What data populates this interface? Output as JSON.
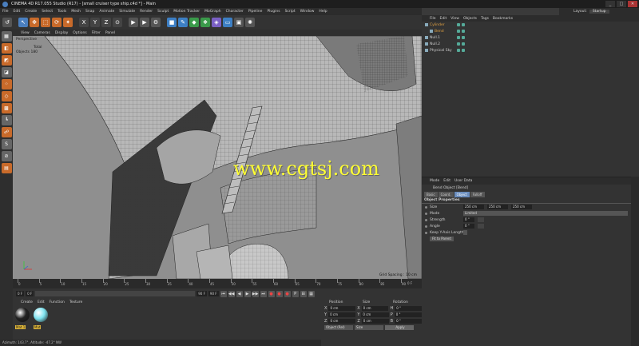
{
  "window": {
    "title": "CINEMA 4D R17.055 Studio (R17) - [small cruiser type ship.c4d *] - Main",
    "controls": [
      "_",
      "□",
      "✕"
    ]
  },
  "menubar": [
    "File",
    "Edit",
    "Create",
    "Select",
    "Tools",
    "Mesh",
    "Snap",
    "Animate",
    "Simulate",
    "Render",
    "Sculpt",
    "Motion Tracker",
    "MoGraph",
    "Character",
    "Pipeline",
    "Plugins",
    "Script",
    "Window",
    "Help"
  ],
  "layout": {
    "label": "Layout:",
    "value": "Startup"
  },
  "toolbar": {
    "items": [
      {
        "icon": "undo-icon",
        "glyph": "↺",
        "color": "#555"
      },
      {
        "icon": "live-select-icon",
        "glyph": "↖",
        "color": "#4a7fbf"
      },
      {
        "icon": "move-icon",
        "glyph": "✥",
        "color": "#c86a2a"
      },
      {
        "icon": "scale-icon",
        "glyph": "⬚",
        "color": "#c86a2a"
      },
      {
        "icon": "rotate-icon",
        "glyph": "⟳",
        "color": "#c86a2a"
      },
      {
        "icon": "recent-icon",
        "glyph": "✦",
        "color": "#c86a2a"
      },
      {
        "icon": "x-axis-icon",
        "glyph": "X",
        "color": "#444"
      },
      {
        "icon": "y-axis-icon",
        "glyph": "Y",
        "color": "#444"
      },
      {
        "icon": "z-axis-icon",
        "glyph": "Z",
        "color": "#444"
      },
      {
        "icon": "coordinate-system-icon",
        "glyph": "⊙",
        "color": "#444"
      },
      {
        "icon": "render-view-icon",
        "glyph": "▶",
        "color": "#555"
      },
      {
        "icon": "render-picture-viewer-icon",
        "glyph": "▶",
        "color": "#555"
      },
      {
        "icon": "render-settings-icon",
        "glyph": "⚙",
        "color": "#555"
      },
      {
        "icon": "cube-icon",
        "glyph": "■",
        "color": "#3d7fc4"
      },
      {
        "icon": "pen-icon",
        "glyph": "✎",
        "color": "#3d7fc4"
      },
      {
        "icon": "subdivision-icon",
        "glyph": "◆",
        "color": "#3a9a4a"
      },
      {
        "icon": "array-icon",
        "glyph": "❖",
        "color": "#3a9a4a"
      },
      {
        "icon": "deformer-icon",
        "glyph": "◈",
        "color": "#7a5fc4"
      },
      {
        "icon": "floor-icon",
        "glyph": "▭",
        "color": "#3d7fc4"
      },
      {
        "icon": "camera-icon",
        "glyph": "▣",
        "color": "#555"
      },
      {
        "icon": "light-icon",
        "glyph": "✺",
        "color": "#555"
      }
    ]
  },
  "left_tools": [
    {
      "icon": "make-editable-icon",
      "glyph": "▦",
      "tone": "g"
    },
    {
      "icon": "model-mode-icon",
      "glyph": "◧",
      "tone": ""
    },
    {
      "icon": "texture-mode-icon",
      "glyph": "◩",
      "tone": ""
    },
    {
      "icon": "workplane-icon",
      "glyph": "◪",
      "tone": "g"
    },
    {
      "icon": "points-mode-icon",
      "glyph": "⁘",
      "tone": ""
    },
    {
      "icon": "edges-mode-icon",
      "glyph": "◇",
      "tone": ""
    },
    {
      "icon": "polygons-mode-icon",
      "glyph": "▩",
      "tone": ""
    },
    {
      "icon": "axis-mode-icon",
      "glyph": "┗",
      "tone": "g"
    },
    {
      "icon": "tweak-icon",
      "glyph": "☍",
      "tone": ""
    },
    {
      "icon": "snap-icon",
      "glyph": "S",
      "tone": "g"
    },
    {
      "icon": "lock-icon",
      "glyph": "⊘",
      "tone": "g"
    },
    {
      "icon": "grid-icon",
      "glyph": "▤",
      "tone": ""
    }
  ],
  "viewport": {
    "menu": [
      "View",
      "Cameras",
      "Display",
      "Options",
      "Filter",
      "Panel"
    ],
    "camera_label": "Perspective",
    "stats_label": "Total",
    "objects_label": "Objects",
    "objects_value": "180",
    "grid_spacing": "Grid Spacing : 10 cm",
    "watermark": "www.cgtsj.com"
  },
  "timeline": {
    "ticks": [
      "0",
      "5",
      "10",
      "15",
      "20",
      "25",
      "30",
      "35",
      "40",
      "45",
      "50",
      "55",
      "60",
      "65",
      "70",
      "75",
      "80",
      "85",
      "90"
    ],
    "frame_end": "0 F"
  },
  "playbar": {
    "start_field": "0 F",
    "current_field": "0 F",
    "end_field": "90 F",
    "end2_field": "90 F",
    "buttons": [
      "⏮",
      "◀◀",
      "◀",
      "▶",
      "▶▶",
      "⏭",
      "●",
      "●",
      "●",
      "P",
      "⊞",
      "▦"
    ]
  },
  "material_panel": {
    "menu": [
      "Create",
      "Edit",
      "Function",
      "Texture"
    ],
    "materials": [
      {
        "name": "Mat.1",
        "color": "#222"
      },
      {
        "name": "Mat",
        "color": "#7fe3ef"
      }
    ],
    "side_label": "MAXON CINEMA 4D"
  },
  "coord_panel": {
    "headers": [
      "Position",
      "Size",
      "Rotation"
    ],
    "rows": [
      {
        "axis": "X",
        "pos": "0 cm",
        "size": "0 cm",
        "rot_axis": "H",
        "rot": "0 °"
      },
      {
        "axis": "Y",
        "pos": "0 cm",
        "size": "0 cm",
        "rot_axis": "P",
        "rot": "0 °"
      },
      {
        "axis": "Z",
        "pos": "0 cm",
        "size": "0 cm",
        "rot_axis": "B",
        "rot": "0 °"
      }
    ],
    "mode_select": "Object (Rel)",
    "size_select": "Size",
    "apply_label": "Apply"
  },
  "object_manager": {
    "menu": [
      "File",
      "Edit",
      "View",
      "Objects",
      "Tags",
      "Bookmarks"
    ],
    "objects": [
      {
        "name": "Cylinder",
        "indent": 0,
        "color": "#e0a040"
      },
      {
        "name": "Bend",
        "indent": 1,
        "color": "#e0a040"
      },
      {
        "name": "Null.1",
        "indent": 0,
        "color": "#cfcfcf"
      },
      {
        "name": "Null.2",
        "indent": 0,
        "color": "#cfcfcf"
      },
      {
        "name": "Physical Sky",
        "indent": 0,
        "color": "#cfcfcf"
      }
    ]
  },
  "attribute_manager": {
    "menu": [
      "Mode",
      "Edit",
      "User Data"
    ],
    "title": "Bend Object [Bend]",
    "tabs": [
      {
        "label": "Basic",
        "active": false
      },
      {
        "label": "Coord.",
        "active": false
      },
      {
        "label": "Object",
        "active": true
      },
      {
        "label": "Falloff",
        "active": false
      }
    ],
    "section": "Object Properties",
    "size_label": "Size",
    "size_values": [
      "250 cm",
      "250 cm",
      "250 cm"
    ],
    "mode_label": "Mode",
    "mode_value": "Limited",
    "strength_label": "Strength",
    "strength_value": "0 °",
    "angle_label": "Angle",
    "angle_value": "0 °",
    "keep_length_label": "Keep Y-Axis Length",
    "fit_button": "Fit to Parent"
  },
  "statusbar": "Azimuth: 143.7°, Altitude: -47.2° NW"
}
